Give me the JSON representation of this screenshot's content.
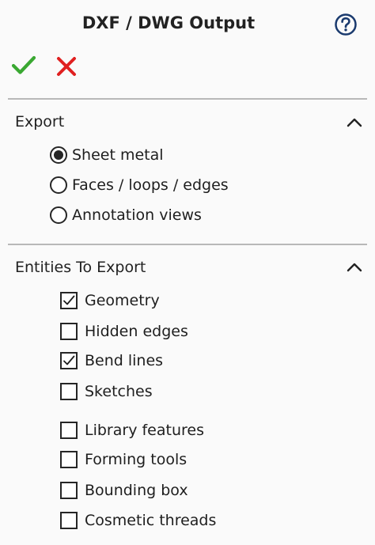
{
  "header": {
    "title": "DXF / DWG Output",
    "help_icon": "question-circle-icon",
    "ok_icon": "checkmark-icon",
    "cancel_icon": "x-icon"
  },
  "colors": {
    "ok": "#3aa832",
    "cancel": "#e02020",
    "help": "#1a3a6e"
  },
  "export": {
    "title": "Export",
    "collapse_icon": "chevron-up-icon",
    "options": [
      {
        "label": "Sheet metal",
        "selected": true
      },
      {
        "label": "Faces / loops / edges",
        "selected": false
      },
      {
        "label": "Annotation views",
        "selected": false
      }
    ]
  },
  "entities": {
    "title": "Entities To Export",
    "collapse_icon": "chevron-up-icon",
    "items": [
      {
        "label": "Geometry",
        "checked": true
      },
      {
        "label": "Hidden edges",
        "checked": false
      },
      {
        "label": "Bend lines",
        "checked": true
      },
      {
        "label": "Sketches",
        "checked": false
      },
      {
        "label": "Library features",
        "checked": false
      },
      {
        "label": "Forming tools",
        "checked": false
      },
      {
        "label": "Bounding box",
        "checked": false
      },
      {
        "label": "Cosmetic threads",
        "checked": false
      }
    ]
  }
}
